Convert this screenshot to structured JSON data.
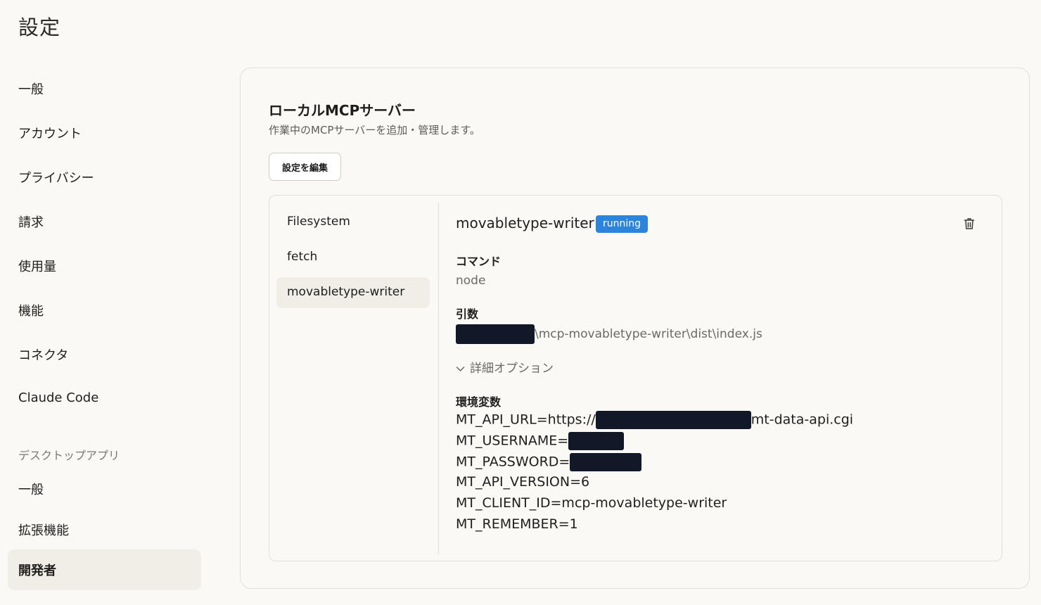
{
  "page_title": "設定",
  "sidebar": {
    "items": [
      {
        "label": "一般"
      },
      {
        "label": "アカウント"
      },
      {
        "label": "プライバシー"
      },
      {
        "label": "請求"
      },
      {
        "label": "使用量"
      },
      {
        "label": "機能"
      },
      {
        "label": "コネクタ"
      },
      {
        "label": "Claude Code"
      }
    ],
    "section_label": "デスクトップアプリ",
    "desktop_items": [
      {
        "label": "一般"
      },
      {
        "label": "拡張機能"
      },
      {
        "label": "開発者"
      }
    ]
  },
  "main": {
    "title": "ローカルMCPサーバー",
    "subtitle": "作業中のMCPサーバーを追加・管理します。",
    "edit_button": "設定を編集",
    "servers": [
      {
        "name": "Filesystem"
      },
      {
        "name": "fetch"
      },
      {
        "name": "movabletype-writer"
      }
    ],
    "selected": {
      "name": "movabletype-writer",
      "status": "running",
      "command_label": "コマンド",
      "command": "node",
      "args_label": "引数",
      "args": "\\mcp-movabletype-writer\\dist\\index.js",
      "advanced_label": "詳細オプション",
      "env_label": "環境変数",
      "env": {
        "api_url_key": "MT_API_URL=https://",
        "api_url_suffix": "mt-data-api.cgi",
        "username_key": "MT_USERNAME=",
        "password_key": "MT_PASSWORD=",
        "api_version": "MT_API_VERSION=6",
        "client_id": "MT_CLIENT_ID=mcp-movabletype-writer",
        "remember": "MT_REMEMBER=1"
      }
    }
  },
  "colors": {
    "background": "#faf9f5",
    "active_bg": "#f0eee6",
    "badge": "#2c84db",
    "redaction": "#111827"
  }
}
